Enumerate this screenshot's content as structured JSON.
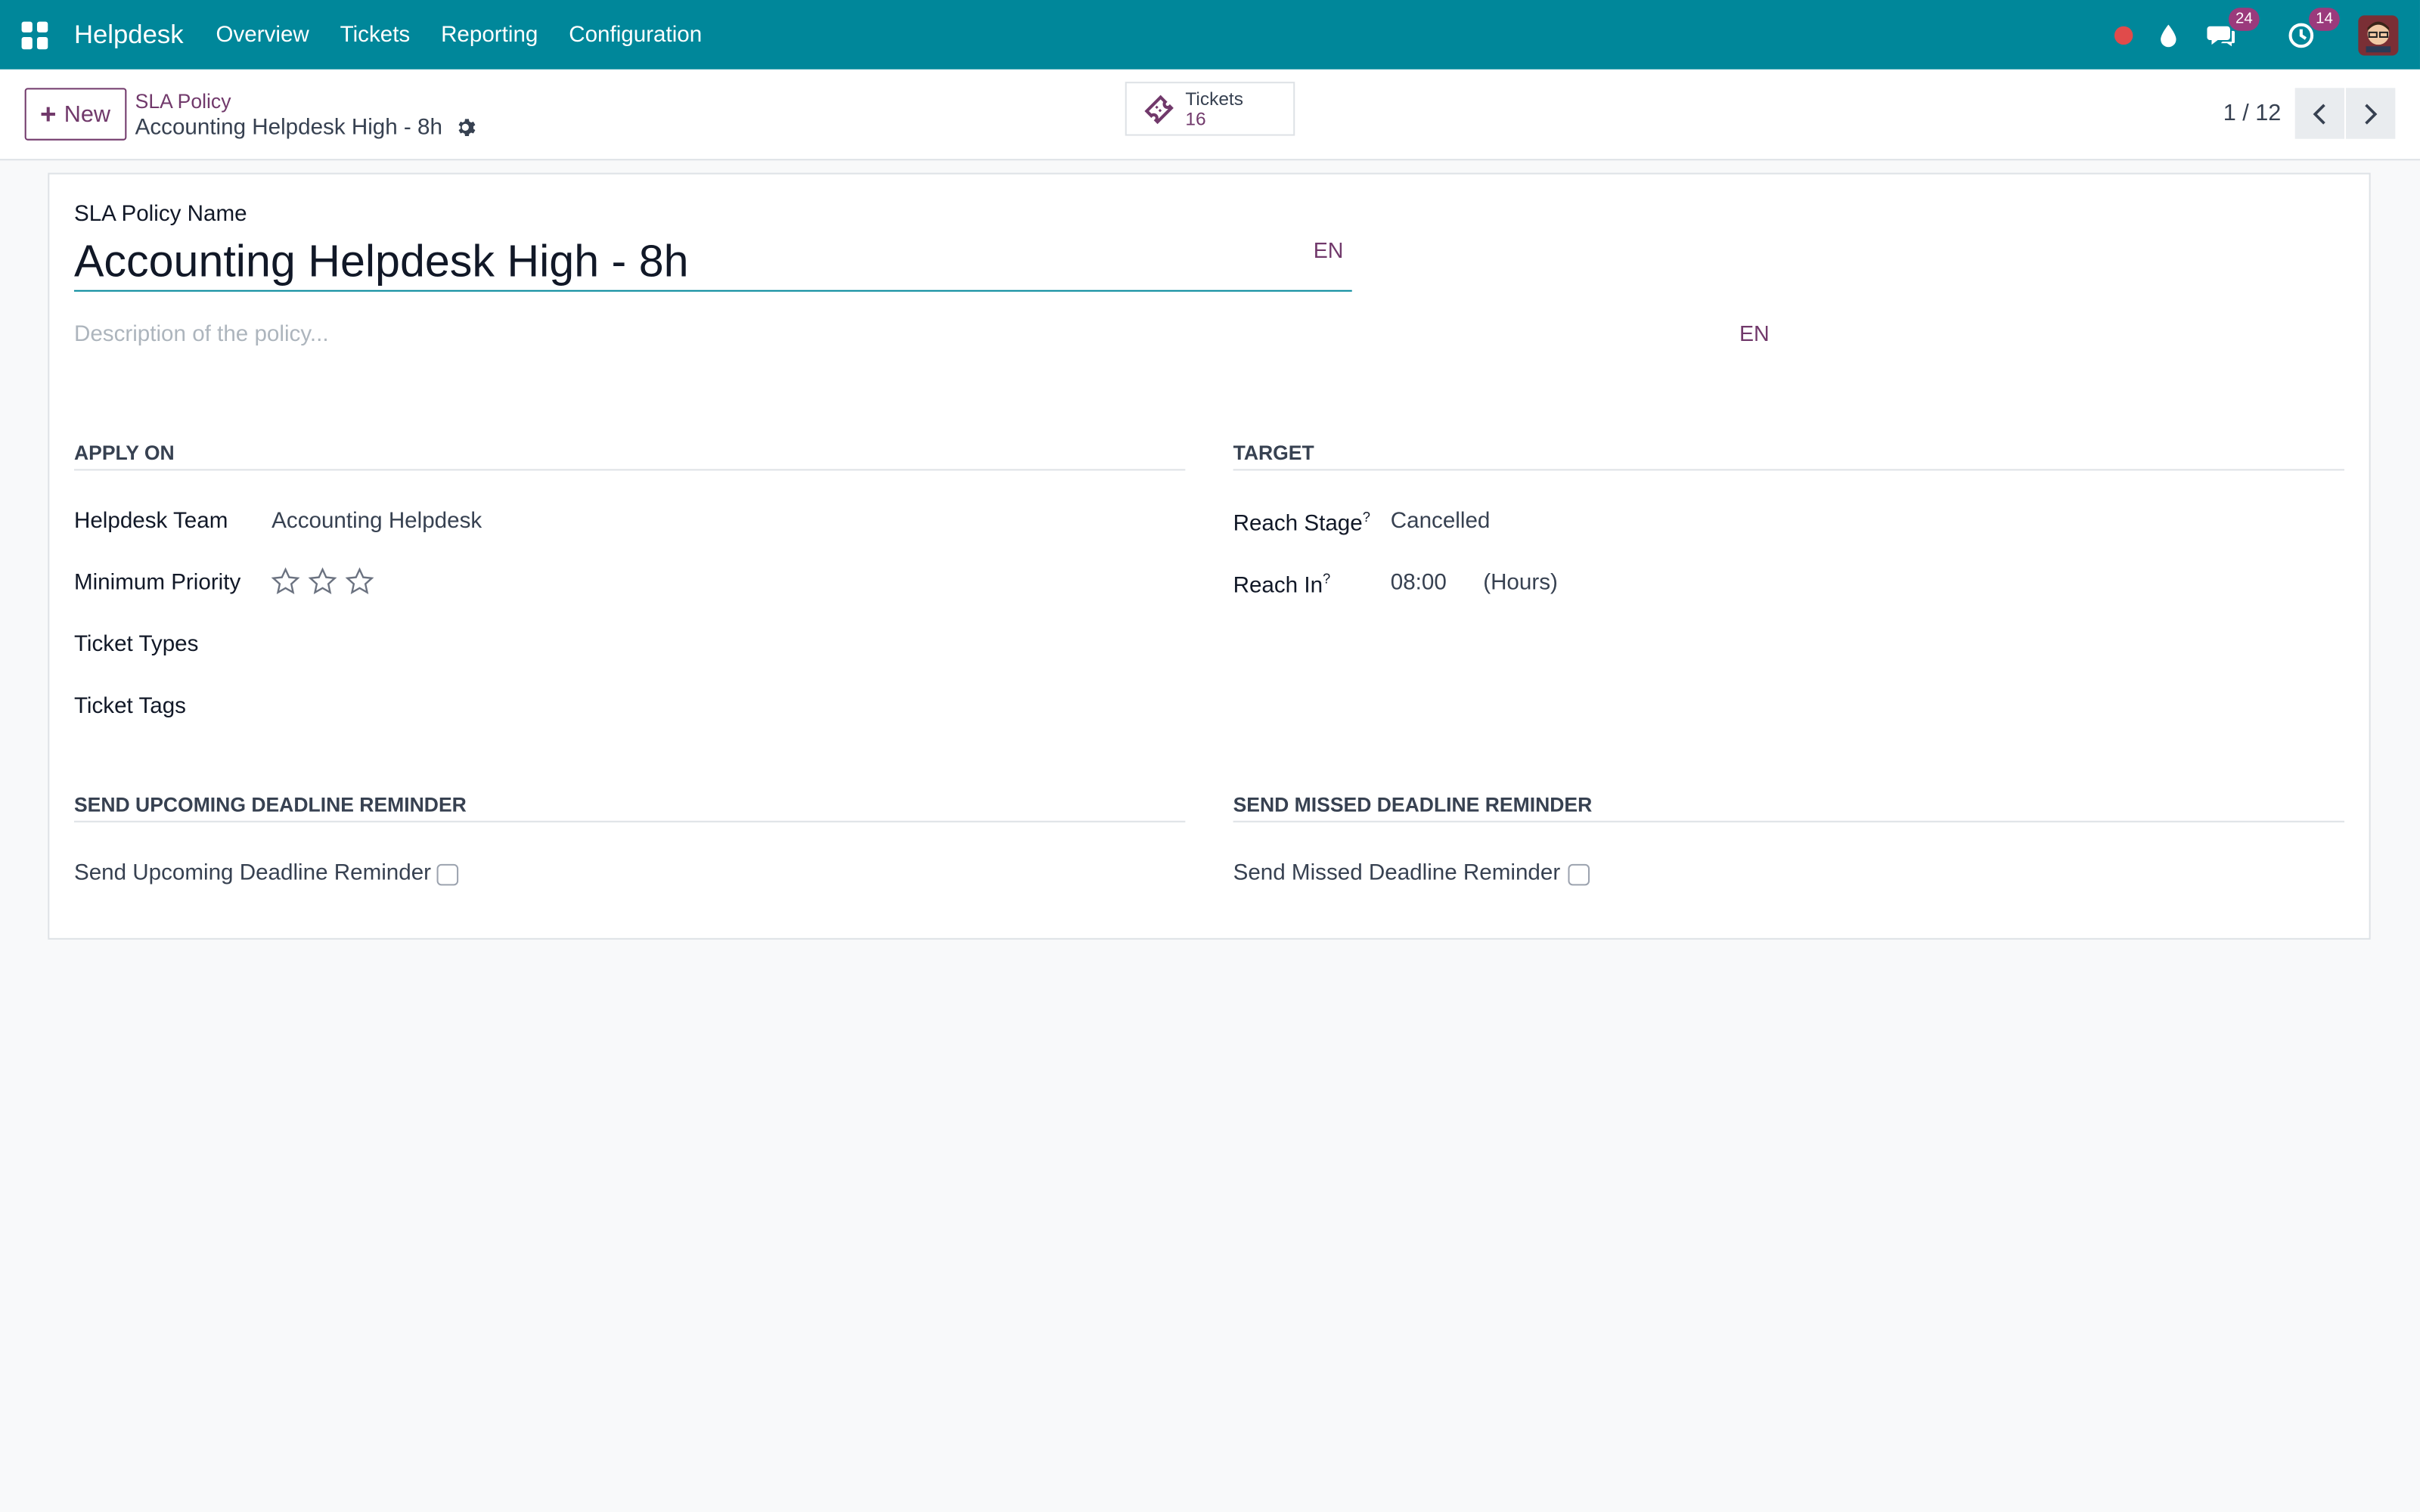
{
  "navbar": {
    "app_name": "Helpdesk",
    "menu": [
      "Overview",
      "Tickets",
      "Reporting",
      "Configuration"
    ],
    "messages_count": "24",
    "activities_count": "14"
  },
  "control": {
    "new_label": "New",
    "breadcrumb_parent": "SLA Policy",
    "breadcrumb_current": "Accounting Helpdesk High - 8h",
    "smart_button": {
      "label": "Tickets",
      "value": "16"
    },
    "pager": "1 / 12"
  },
  "form": {
    "name_label": "SLA Policy Name",
    "name_value": "Accounting Helpdesk High - 8h",
    "lang": "EN",
    "description_placeholder": "Description of the policy...",
    "apply_on": {
      "title": "APPLY ON",
      "team_label": "Helpdesk Team",
      "team_value": "Accounting Helpdesk",
      "priority_label": "Minimum Priority",
      "priority_stars_filled": 0,
      "priority_stars_total": 3,
      "types_label": "Ticket Types",
      "tags_label": "Ticket Tags"
    },
    "target": {
      "title": "TARGET",
      "stage_label": "Reach Stage",
      "stage_value": "Cancelled",
      "reach_label": "Reach In",
      "reach_value": "08:00",
      "reach_unit": "(Hours)",
      "help": "?"
    },
    "upcoming": {
      "title": "SEND UPCOMING DEADLINE REMINDER",
      "label": "Send Upcoming Deadline Reminder"
    },
    "missed": {
      "title": "SEND MISSED DEADLINE REMINDER",
      "label": "Send Missed Deadline Reminder"
    }
  },
  "colors": {
    "navbar": "#00879a",
    "accent": "#71396b",
    "badge": "#9b3a7c"
  }
}
